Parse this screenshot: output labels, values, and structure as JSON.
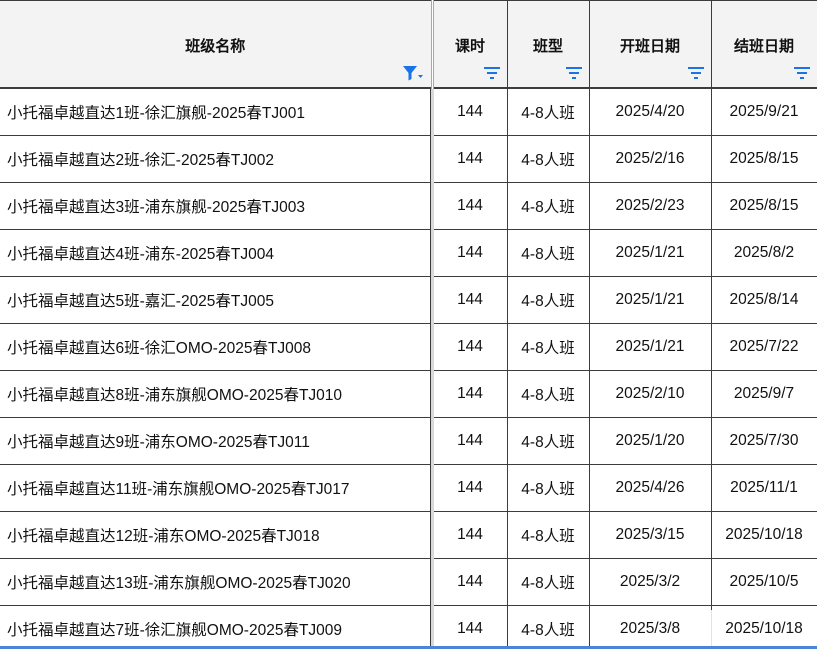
{
  "colors": {
    "filter_active": "#1a73e8",
    "filter_icon": "#1a73e8",
    "header_bg": "#f3f3f3",
    "grid_line": "#3c3c3c",
    "selection_bar": "#4a86d8"
  },
  "columns": [
    {
      "label": "班级名称",
      "filter_icon": "filter-active-icon"
    },
    {
      "label": "课时",
      "filter_icon": "filter-icon"
    },
    {
      "label": "班型",
      "filter_icon": "filter-icon"
    },
    {
      "label": "开班日期",
      "filter_icon": "filter-icon"
    },
    {
      "label": "结班日期",
      "filter_icon": "filter-icon"
    }
  ],
  "rows": [
    {
      "name": "小托福卓越直达1班-徐汇旗舰-2025春TJ001",
      "hours": "144",
      "type": "4-8人班",
      "start": "2025/4/20",
      "end": "2025/9/21"
    },
    {
      "name": "小托福卓越直达2班-徐汇-2025春TJ002",
      "hours": "144",
      "type": "4-8人班",
      "start": "2025/2/16",
      "end": "2025/8/15"
    },
    {
      "name": "小托福卓越直达3班-浦东旗舰-2025春TJ003",
      "hours": "144",
      "type": "4-8人班",
      "start": "2025/2/23",
      "end": "2025/8/15"
    },
    {
      "name": "小托福卓越直达4班-浦东-2025春TJ004",
      "hours": "144",
      "type": "4-8人班",
      "start": "2025/1/21",
      "end": "2025/8/2"
    },
    {
      "name": "小托福卓越直达5班-嘉汇-2025春TJ005",
      "hours": "144",
      "type": "4-8人班",
      "start": "2025/1/21",
      "end": "2025/8/14"
    },
    {
      "name": "小托福卓越直达6班-徐汇OMO-2025春TJ008",
      "hours": "144",
      "type": "4-8人班",
      "start": "2025/1/21",
      "end": "2025/7/22"
    },
    {
      "name": "小托福卓越直达8班-浦东旗舰OMO-2025春TJ010",
      "hours": "144",
      "type": "4-8人班",
      "start": "2025/2/10",
      "end": "2025/9/7"
    },
    {
      "name": "小托福卓越直达9班-浦东OMO-2025春TJ011",
      "hours": "144",
      "type": "4-8人班",
      "start": "2025/1/20",
      "end": "2025/7/30"
    },
    {
      "name": "小托福卓越直达11班-浦东旗舰OMO-2025春TJ017",
      "hours": "144",
      "type": "4-8人班",
      "start": "2025/4/26",
      "end": "2025/11/1"
    },
    {
      "name": "小托福卓越直达12班-浦东OMO-2025春TJ018",
      "hours": "144",
      "type": "4-8人班",
      "start": "2025/3/15",
      "end": "2025/10/18"
    },
    {
      "name": "小托福卓越直达13班-浦东旗舰OMO-2025春TJ020",
      "hours": "144",
      "type": "4-8人班",
      "start": "2025/3/2",
      "end": "2025/10/5"
    },
    {
      "name": "小托福卓越直达7班-徐汇旗舰OMO-2025春TJ009",
      "hours": "144",
      "type": "4-8人班",
      "start": "2025/3/8",
      "end": "2025/10/18"
    }
  ]
}
